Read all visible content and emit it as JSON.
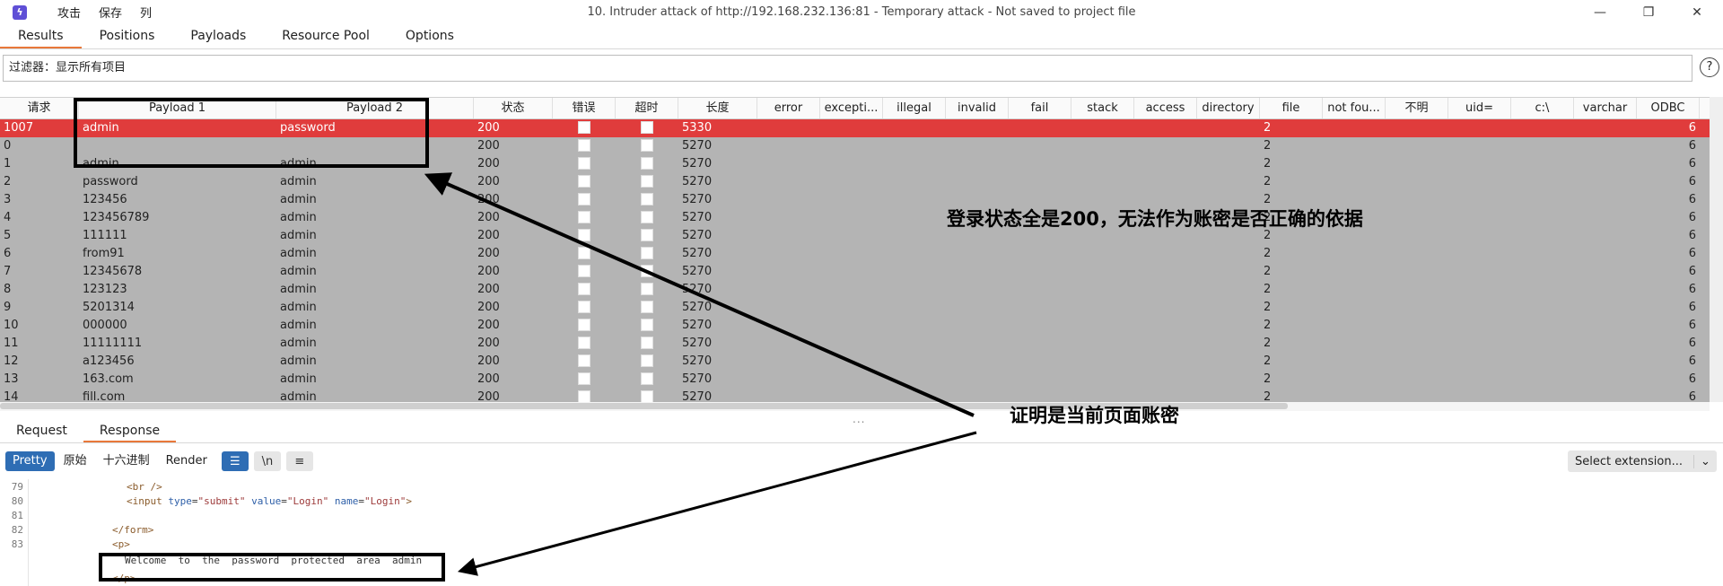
{
  "app": {
    "menu": [
      "攻击",
      "保存",
      "列"
    ],
    "title": "10. Intruder attack of http://192.168.232.136:81 - Temporary attack - Not saved to project file",
    "minimize": "—",
    "restore": "❐",
    "close": "✕"
  },
  "tabs": [
    "Results",
    "Positions",
    "Payloads",
    "Resource Pool",
    "Options"
  ],
  "filter": {
    "text": "过滤器：显示所有项目",
    "help": "?"
  },
  "table": {
    "columns": [
      "请求",
      "Payload 1",
      "Payload 2",
      "状态",
      "错误",
      "超时",
      "长度",
      "error",
      "excepti...",
      "illegal",
      "invalid",
      "fail",
      "stack",
      "access",
      "directory",
      "file",
      "not fou...",
      "不明",
      "uid=",
      "c:\\",
      "varchar",
      "ODBC"
    ],
    "rows": [
      {
        "req": "1007",
        "p1": "admin",
        "p2": "password",
        "status": "200",
        "len": "5330",
        "file": "2",
        "end": "6"
      },
      {
        "req": "0",
        "p1": "",
        "p2": "",
        "status": "200",
        "len": "5270",
        "file": "2",
        "end": "6"
      },
      {
        "req": "1",
        "p1": "admin",
        "p2": "admin",
        "status": "200",
        "len": "5270",
        "file": "2",
        "end": "6"
      },
      {
        "req": "2",
        "p1": "password",
        "p2": "admin",
        "status": "200",
        "len": "5270",
        "file": "2",
        "end": "6"
      },
      {
        "req": "3",
        "p1": "123456",
        "p2": "admin",
        "status": "200",
        "len": "5270",
        "file": "2",
        "end": "6"
      },
      {
        "req": "4",
        "p1": "123456789",
        "p2": "admin",
        "status": "200",
        "len": "5270",
        "file": "2",
        "end": "6"
      },
      {
        "req": "5",
        "p1": "111111",
        "p2": "admin",
        "status": "200",
        "len": "5270",
        "file": "2",
        "end": "6"
      },
      {
        "req": "6",
        "p1": "from91",
        "p2": "admin",
        "status": "200",
        "len": "5270",
        "file": "2",
        "end": "6"
      },
      {
        "req": "7",
        "p1": "12345678",
        "p2": "admin",
        "status": "200",
        "len": "5270",
        "file": "2",
        "end": "6"
      },
      {
        "req": "8",
        "p1": "123123",
        "p2": "admin",
        "status": "200",
        "len": "5270",
        "file": "2",
        "end": "6"
      },
      {
        "req": "9",
        "p1": "5201314",
        "p2": "admin",
        "status": "200",
        "len": "5270",
        "file": "2",
        "end": "6"
      },
      {
        "req": "10",
        "p1": "000000",
        "p2": "admin",
        "status": "200",
        "len": "5270",
        "file": "2",
        "end": "6"
      },
      {
        "req": "11",
        "p1": "11111111",
        "p2": "admin",
        "status": "200",
        "len": "5270",
        "file": "2",
        "end": "6"
      },
      {
        "req": "12",
        "p1": "a123456",
        "p2": "admin",
        "status": "200",
        "len": "5270",
        "file": "2",
        "end": "6"
      },
      {
        "req": "13",
        "p1": "163.com",
        "p2": "admin",
        "status": "200",
        "len": "5270",
        "file": "2",
        "end": "6"
      },
      {
        "req": "14",
        "p1": "fill.com",
        "p2": "admin",
        "status": "200",
        "len": "5270",
        "file": "2",
        "end": "6"
      }
    ]
  },
  "splitter": "...",
  "request_response_tabs": [
    "Request",
    "Response"
  ],
  "toolbar": {
    "buttons": [
      "Pretty",
      "原始",
      "十六进制",
      "Render"
    ],
    "wrap_icon": "☰",
    "newline_icon": "\\n",
    "menu_icon": "≡",
    "select_extension": "Select extension...",
    "chevron": "⌄"
  },
  "code": {
    "line_numbers": [
      "79",
      "80",
      "81",
      "82",
      "83"
    ],
    "line79": "<br />",
    "line80_tag_open": "<input ",
    "line80_attr1": "type",
    "line80_val1": "\"submit\"",
    "line80_attr2": "value",
    "line80_val2": "\"Login\"",
    "line80_attr3": "name",
    "line80_val3": "\"Login\"",
    "line80_close": ">",
    "line82": "</form>",
    "line83": "<p>",
    "welcome": "Welcome  to  the  password  protected  area  admin",
    "line_last": "</p>"
  },
  "annotations": {
    "note1": "登录状态全是200，无法作为账密是否正确的依据",
    "note2": "证明是当前页面账密"
  },
  "colors": {
    "selected_row": "#e03c3c",
    "row_bg": "#b4b4b4",
    "accent_tab": "#e8783a",
    "active_button": "#2e6db4"
  }
}
